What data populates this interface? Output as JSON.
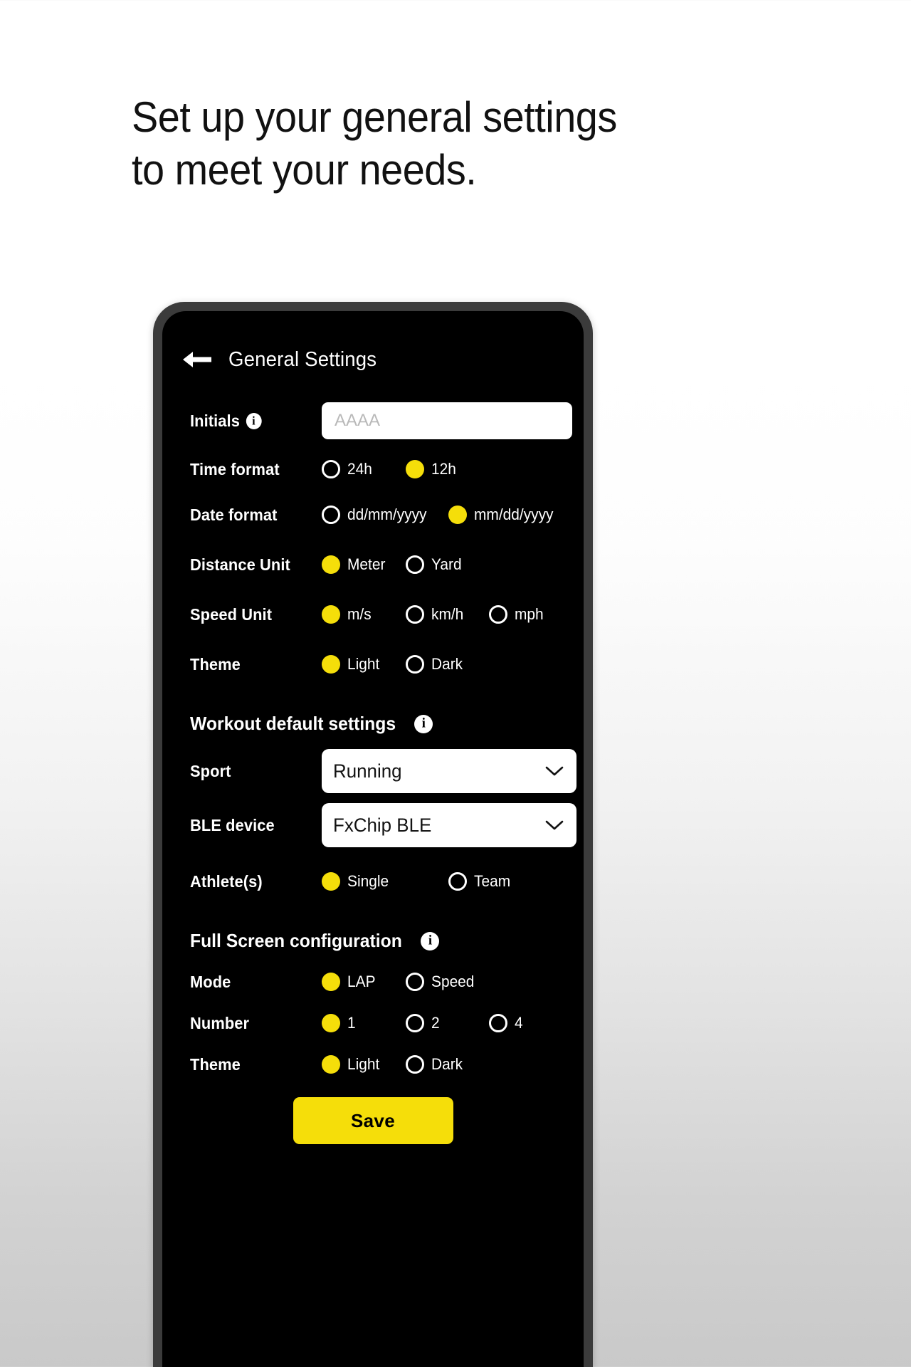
{
  "promo": {
    "headline_line1": "Set up your general settings",
    "headline_line2": "to meet your needs."
  },
  "colors": {
    "accent_yellow": "#F5DE0A",
    "screen_background": "#000000",
    "phone_bezel": "#3B3B3B",
    "text_primary": "#FFFFFF"
  },
  "app": {
    "header": {
      "back_icon": "back-arrow-icon",
      "title": "General Settings"
    },
    "general": {
      "initials": {
        "label": "Initials",
        "info_icon": "info-icon",
        "placeholder": "AAAA",
        "value": ""
      },
      "time_format": {
        "label": "Time format",
        "options": [
          {
            "label": "24h",
            "selected": false
          },
          {
            "label": "12h",
            "selected": true
          }
        ]
      },
      "date_format": {
        "label": "Date format",
        "options": [
          {
            "label": "dd/mm/yyyy",
            "selected": false
          },
          {
            "label": "mm/dd/yyyy",
            "selected": true
          }
        ]
      },
      "distance_unit": {
        "label": "Distance Unit",
        "options": [
          {
            "label": "Meter",
            "selected": true
          },
          {
            "label": "Yard",
            "selected": false
          }
        ]
      },
      "speed_unit": {
        "label": "Speed Unit",
        "options": [
          {
            "label": "m/s",
            "selected": true
          },
          {
            "label": "km/h",
            "selected": false
          },
          {
            "label": "mph",
            "selected": false
          }
        ]
      },
      "theme": {
        "label": "Theme",
        "options": [
          {
            "label": "Light",
            "selected": true
          },
          {
            "label": "Dark",
            "selected": false
          }
        ]
      }
    },
    "workout_defaults": {
      "section_title": "Workout default settings",
      "info_icon": "info-icon",
      "sport": {
        "label": "Sport",
        "value": "Running",
        "chevron_icon": "chevron-down-icon"
      },
      "ble_device": {
        "label": "BLE device",
        "value": "FxChip BLE",
        "chevron_icon": "chevron-down-icon"
      },
      "athletes": {
        "label": "Athlete(s)",
        "options": [
          {
            "label": "Single",
            "selected": true
          },
          {
            "label": "Team",
            "selected": false
          }
        ]
      }
    },
    "fullscreen_config": {
      "section_title": "Full Screen configuration",
      "info_icon": "info-icon",
      "mode": {
        "label": "Mode",
        "options": [
          {
            "label": "LAP",
            "selected": true
          },
          {
            "label": "Speed",
            "selected": false
          }
        ]
      },
      "number": {
        "label": "Number",
        "options": [
          {
            "label": "1",
            "selected": true
          },
          {
            "label": "2",
            "selected": false
          },
          {
            "label": "4",
            "selected": false
          }
        ]
      },
      "theme": {
        "label": "Theme",
        "options": [
          {
            "label": "Light",
            "selected": true
          },
          {
            "label": "Dark",
            "selected": false
          }
        ]
      }
    },
    "save_button": {
      "label": "Save"
    }
  }
}
